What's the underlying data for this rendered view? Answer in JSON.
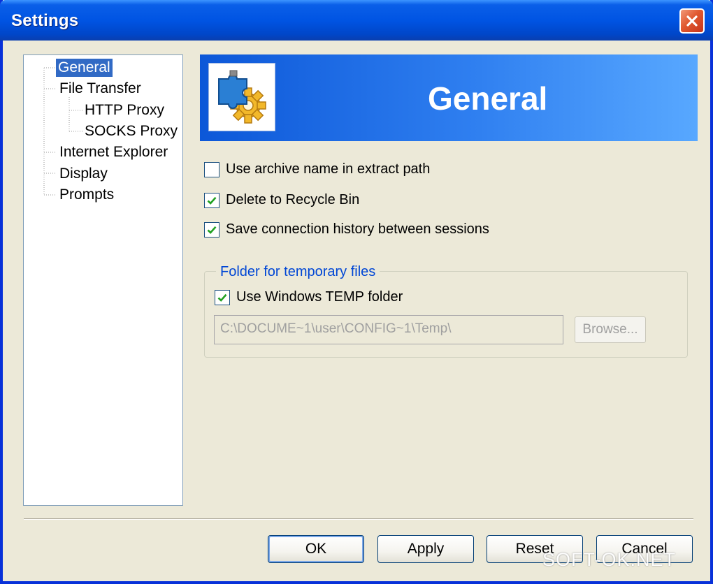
{
  "window": {
    "title": "Settings"
  },
  "tree": {
    "items": [
      {
        "label": "General",
        "selected": true
      },
      {
        "label": "File Transfer"
      },
      {
        "label": "HTTP Proxy"
      },
      {
        "label": "SOCKS Proxy"
      },
      {
        "label": "Internet Explorer"
      },
      {
        "label": "Display"
      },
      {
        "label": "Prompts"
      }
    ]
  },
  "banner": {
    "title": "General",
    "icon": "puzzle-gear-icon"
  },
  "options": {
    "use_archive_name": {
      "label": "Use archive name in extract path",
      "checked": false
    },
    "delete_to_recycle_bin": {
      "label": "Delete to Recycle Bin",
      "checked": true
    },
    "save_connection_history": {
      "label": "Save connection history between sessions",
      "checked": true
    }
  },
  "temp_folder_group": {
    "title": "Folder for temporary files",
    "use_windows_temp": {
      "label": "Use Windows TEMP folder",
      "checked": true
    },
    "path_value": "C:\\DOCUME~1\\user\\CONFIG~1\\Temp\\",
    "browse_label": "Browse..."
  },
  "buttons": {
    "ok": "OK",
    "apply": "Apply",
    "reset": "Reset",
    "cancel": "Cancel"
  },
  "watermark": "SOFT-OK.NET",
  "colors": {
    "title_bar": "#0054e3",
    "selection": "#316ac5",
    "group_title": "#0046d5",
    "close_button": "#e0582f"
  }
}
